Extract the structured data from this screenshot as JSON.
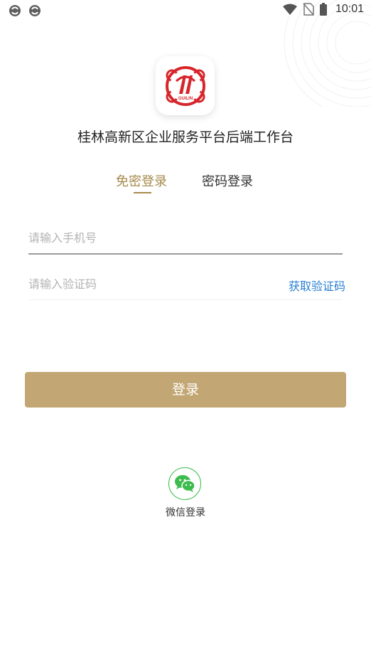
{
  "status_bar": {
    "time": "10:01",
    "left_icons": [
      "sync-icon",
      "sync-icon"
    ],
    "right_icons": [
      "wifi-icon",
      "no-sim-icon",
      "battery-icon"
    ]
  },
  "app": {
    "logo_icon": "guilin-logo-icon",
    "logo_text": "GUILIN",
    "title": "桂林高新区企业服务平台后端工作台"
  },
  "tabs": [
    {
      "label": "免密登录",
      "active": true
    },
    {
      "label": "密码登录",
      "active": false
    }
  ],
  "form": {
    "phone": {
      "value": "",
      "placeholder": "请输入手机号"
    },
    "code": {
      "value": "",
      "placeholder": "请输入验证码"
    },
    "get_code_label": "获取验证码"
  },
  "login_button_label": "登录",
  "wechat": {
    "icon": "wechat-icon",
    "label": "微信登录"
  },
  "colors": {
    "accent_gold": "#a58a4c",
    "button_gold": "#c2a673",
    "link_blue": "#2a7fd4",
    "wechat_green": "#3dbb4e",
    "logo_red": "#d7262b"
  }
}
